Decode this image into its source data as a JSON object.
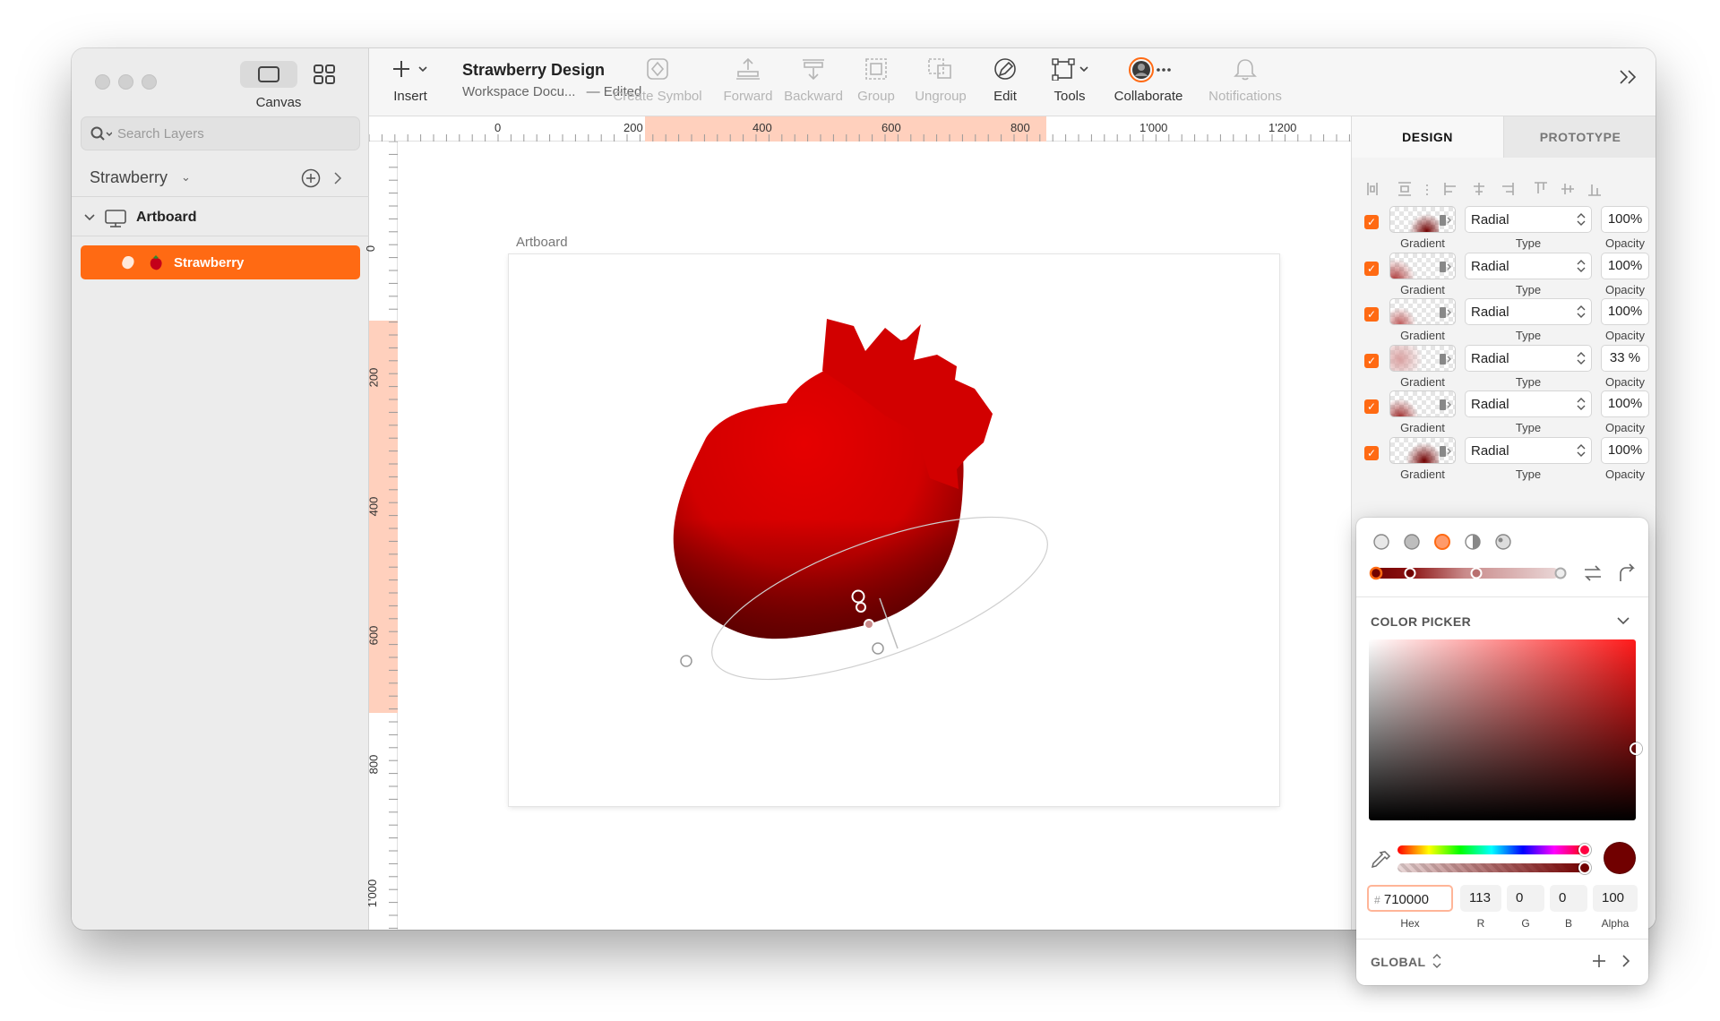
{
  "sidebar": {
    "canvas_label": "Canvas",
    "search_placeholder": "Search Layers",
    "page_name": "Strawberry",
    "artboard_name": "Artboard",
    "layer_name": "Strawberry"
  },
  "toolbar": {
    "insert": "Insert",
    "doc_title": "Strawberry Design",
    "doc_subtitle": "Workspace Docu...",
    "doc_status": "— Edited",
    "create_symbol": "Create Symbol",
    "forward": "Forward",
    "backward": "Backward",
    "group": "Group",
    "ungroup": "Ungroup",
    "edit": "Edit",
    "tools": "Tools",
    "collaborate": "Collaborate",
    "notifications": "Notifications"
  },
  "rulers": {
    "h_labels": [
      "0",
      "200",
      "400",
      "600",
      "800",
      "1'000",
      "1'200"
    ],
    "v_labels": [
      "0",
      "200",
      "400",
      "600",
      "800",
      "1'000"
    ]
  },
  "canvas": {
    "artboard_label": "Artboard"
  },
  "inspector": {
    "tab_design": "DESIGN",
    "tab_prototype": "PROTOTYPE",
    "sub_gradient": "Gradient",
    "sub_type": "Type",
    "sub_opacity": "Opacity",
    "fills": [
      {
        "type": "Radial",
        "opacity": "100%",
        "checked": true
      },
      {
        "type": "Radial",
        "opacity": "100%",
        "checked": true
      },
      {
        "type": "Radial",
        "opacity": "100%",
        "checked": true
      },
      {
        "type": "Radial",
        "opacity": "33 %",
        "checked": true
      },
      {
        "type": "Radial",
        "opacity": "100%",
        "checked": true
      },
      {
        "type": "Radial",
        "opacity": "100%",
        "checked": true
      }
    ]
  },
  "color_picker": {
    "section_title": "COLOR PICKER",
    "hex_prefix": "#",
    "hex": "710000",
    "r": "113",
    "g": "0",
    "b": "0",
    "alpha": "100",
    "hex_label": "Hex",
    "r_label": "R",
    "g_label": "G",
    "b_label": "B",
    "alpha_label": "Alpha",
    "global_label": "GLOBAL",
    "current_color": "#710000"
  },
  "colors": {
    "accent": "#ff6a13",
    "strawberry": "#d40000"
  }
}
